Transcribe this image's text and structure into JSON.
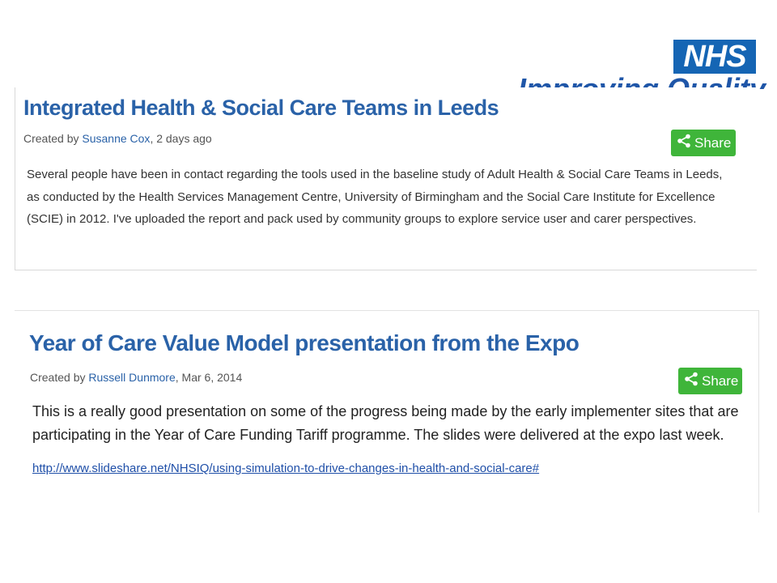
{
  "header": {
    "logo_text": "NHS",
    "heading_fragment": "Improving Quality"
  },
  "posts": [
    {
      "title": "Integrated Health & Social Care Teams in Leeds",
      "created_by_prefix": "Created by ",
      "author": "Susanne Cox",
      "date": ", 2 days ago",
      "share_label": "Share",
      "body": "Several people have been in contact regarding the tools used in the baseline study of Adult Health & Social Care Teams in Leeds, as conducted by the Health Services Management Centre, University of Birmingham and the Social Care Institute for Excellence (SCIE) in 2012. I've uploaded the report and pack used by community groups to explore service user and carer perspectives."
    },
    {
      "title": "Year of Care Value Model presentation from the Expo",
      "created_by_prefix": "Created by ",
      "author": "Russell Dunmore",
      "date": ", Mar 6, 2014",
      "share_label": "Share",
      "body": "This is a really good presentation on some of the progress being made by the early implementer sites that are participating in the Year of Care Funding Tariff programme.  The slides were delivered at the expo last week.",
      "link": "http://www.slideshare.net/NHSIQ/using-simulation-to-drive-changes-in-health-and-social-care#"
    }
  ],
  "colors": {
    "nhs_blue": "#1565b4",
    "title_blue": "#2a62a8",
    "share_green": "#3fb53a"
  },
  "icons": {
    "share": "share-icon"
  }
}
